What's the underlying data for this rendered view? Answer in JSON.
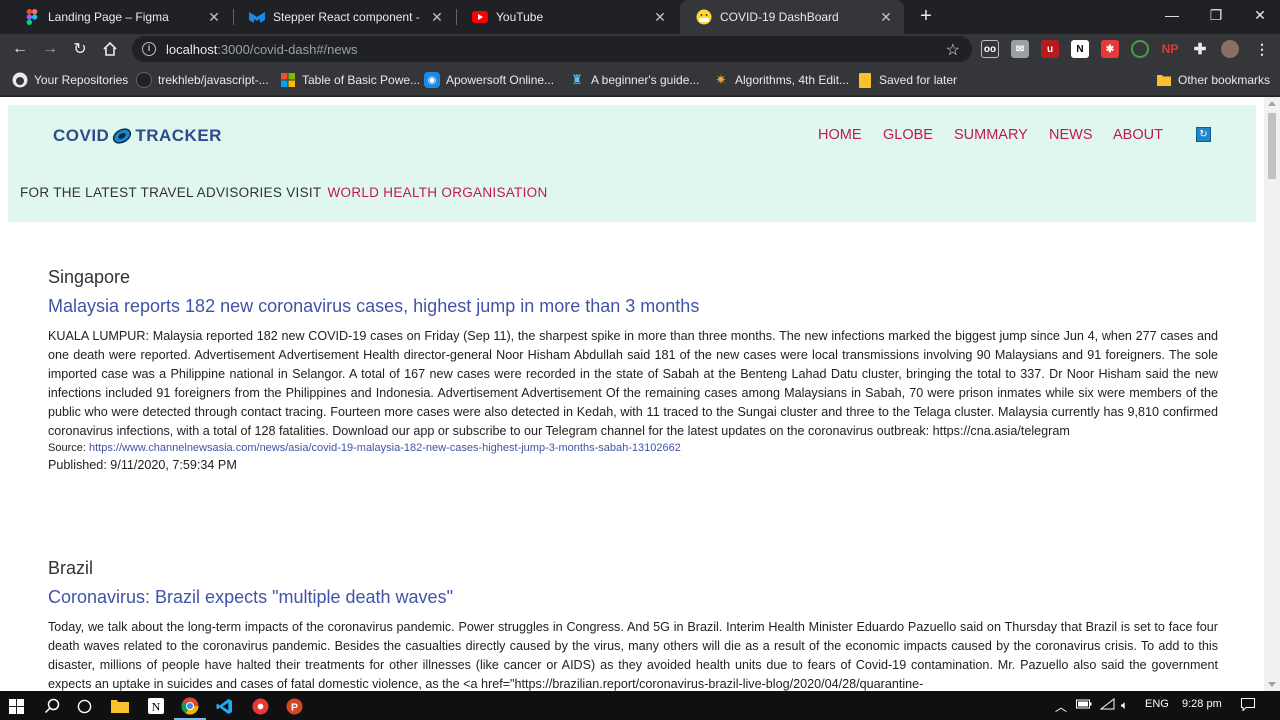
{
  "browser": {
    "tabs": [
      {
        "title": "Landing Page – Figma",
        "favicon": "figma-icon",
        "active": false
      },
      {
        "title": "Stepper React component - Mate",
        "favicon": "mui-icon",
        "active": false
      },
      {
        "title": "YouTube",
        "favicon": "youtube-icon",
        "active": false
      },
      {
        "title": "COVID-19 DashBoard",
        "favicon": "emoji-icon",
        "active": true
      }
    ],
    "url_host": "localhost",
    "url_rest": ":3000/covid-dash#/news",
    "bookmarks": [
      {
        "label": "Your Repositories",
        "icon": "github-icon"
      },
      {
        "label": "trekhleb/javascript-...",
        "icon": "github-icon"
      },
      {
        "label": "Table of Basic Powe...",
        "icon": "microsoft-icon"
      },
      {
        "label": "Apowersoft Online...",
        "icon": "apowersoft-icon"
      },
      {
        "label": "A beginner's guide...",
        "icon": "bookmark-icon"
      },
      {
        "label": "Algorithms, 4th Edit...",
        "icon": "algorithms-icon"
      },
      {
        "label": "Saved for later",
        "icon": "folder-icon"
      }
    ],
    "other_bookmarks": "Other bookmarks"
  },
  "site": {
    "logo_left": "COVID",
    "logo_right": "TRACKER",
    "nav": [
      "HOME",
      "GLOBE",
      "SUMMARY",
      "NEWS",
      "ABOUT"
    ],
    "advisory_text": "FOR THE LATEST TRAVEL ADVISORIES VISIT",
    "advisory_link": "WORLD HEALTH ORGANISATION"
  },
  "articles": [
    {
      "country": "Singapore",
      "headline": "Malaysia reports 182 new coronavirus cases, highest jump in more than 3 months",
      "body": "KUALA LUMPUR: Malaysia reported 182 new COVID-19 cases on Friday (Sep 11), the sharpest spike in more than three months. The new infections marked the biggest jump since Jun 4, when 277 cases and one death were reported. Advertisement Advertisement Health director-general Noor Hisham Abdullah said 181 of the new cases were local transmissions involving 90 Malaysians and 91 foreigners. The sole imported case was a Philippine national in Selangor. A total of 167 new cases were recorded in the state of Sabah at the Benteng Lahad Datu cluster, bringing the total to 337. Dr Noor Hisham said the new infections included 91 foreigners from the Philippines and Indonesia. Advertisement Advertisement Of the remaining cases among Malaysians in Sabah, 70 were prison inmates while six were members of the public who were detected through contact tracing. Fourteen more cases were also detected in Kedah, with 11 traced to the Sungai cluster and three to the Telaga cluster. Malaysia currently has 9,810 confirmed coronavirus infections, with a total of 128 fatalities. Download our app or subscribe to our Telegram channel for the latest updates on the coronavirus outbreak: https://cna.asia/telegram",
      "source_label": "Source:",
      "source_url": "https://www.channelnewsasia.com/news/asia/covid-19-malaysia-182-new-cases-highest-jump-3-months-sabah-13102662",
      "published": "Published: 9/11/2020, 7:59:34 PM"
    },
    {
      "country": "Brazil",
      "headline": "Coronavirus: Brazil expects \"multiple death waves\"",
      "body": "Today, we talk about the long-term impacts of the coronavirus pandemic. Power struggles in Congress. And 5G in Brazil. Interim Health Minister Eduardo Pazuello said on Thursday that Brazil is set to face four death waves related to the coronavirus pandemic. Besides the casualties directly caused by the virus, many others will die as a result of the economic impacts caused by the coronavirus crisis. To add to this disaster, millions of people have halted their treatments for other illnesses (like cancer or AIDS) as they avoided health units due to fears of Covid-19 contamination. Mr. Pazuello also said the government expects an uptake in suicides and cases of fatal domestic violence, as the <a href=\"https://brazilian.report/coronavirus-brazil-live-blog/2020/04/28/quarantine-"
    }
  ],
  "taskbar": {
    "lang": "ENG",
    "time": "9:28 pm"
  }
}
